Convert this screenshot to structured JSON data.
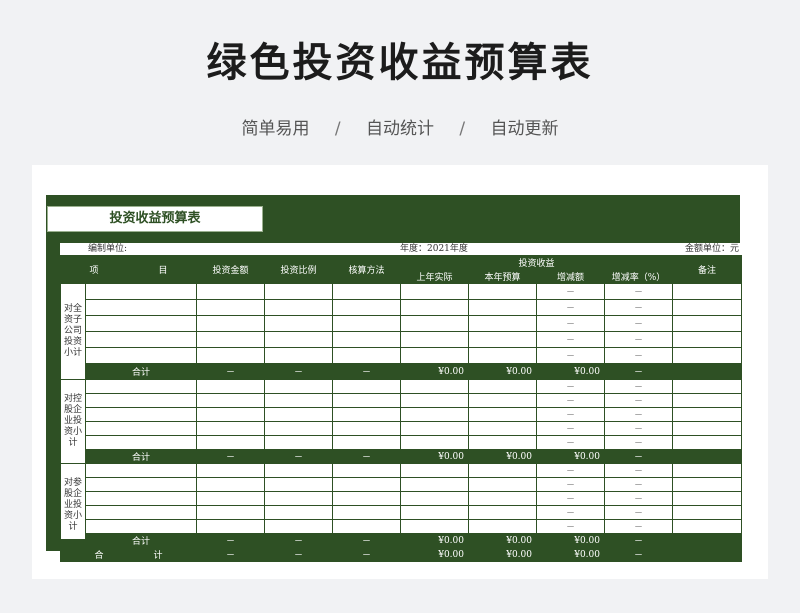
{
  "header": {
    "title": "绿色投资收益预算表",
    "tags": [
      "简单易用",
      "自动统计",
      "自动更新"
    ],
    "separator": "/"
  },
  "sheet": {
    "title": "投资收益预算表",
    "unit_label": "编制单位:",
    "year_label": "年度：2021年度",
    "currency_label": "金额单位：元"
  },
  "columns": {
    "item_1": "项",
    "item_2": "目",
    "amount": "投资金额",
    "ratio": "投资比例",
    "method": "核算方法",
    "income_group": "投资收益",
    "last_year": "上年实际",
    "this_year": "本年预算",
    "change": "增减额",
    "change_rate": "增减率（%）",
    "note": "备注"
  },
  "groups": [
    {
      "label": "对全资子公司投资小计"
    },
    {
      "label": "对控股企业投资小计"
    },
    {
      "label": "对参股企业投资小计"
    }
  ],
  "subtotal": {
    "label": "合计",
    "dash": "－",
    "amount": "¥0.00"
  },
  "grand_total": {
    "label_1": "合",
    "label_2": "计"
  },
  "colors": {
    "accent": "#2e5024",
    "background": "#f1f2f4"
  }
}
